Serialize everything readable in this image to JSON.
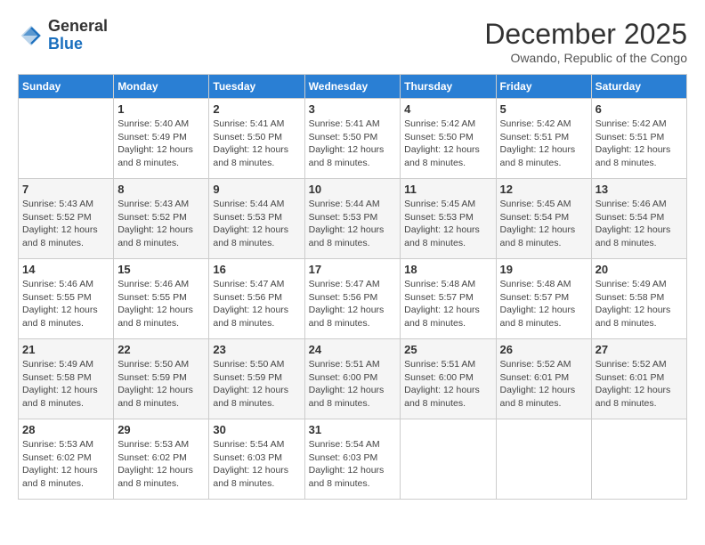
{
  "logo": {
    "general": "General",
    "blue": "Blue"
  },
  "header": {
    "month": "December 2025",
    "location": "Owando, Republic of the Congo"
  },
  "days_of_week": [
    "Sunday",
    "Monday",
    "Tuesday",
    "Wednesday",
    "Thursday",
    "Friday",
    "Saturday"
  ],
  "weeks": [
    [
      {
        "day": "",
        "info": ""
      },
      {
        "day": "1",
        "info": "Sunrise: 5:40 AM\nSunset: 5:49 PM\nDaylight: 12 hours\nand 8 minutes."
      },
      {
        "day": "2",
        "info": "Sunrise: 5:41 AM\nSunset: 5:50 PM\nDaylight: 12 hours\nand 8 minutes."
      },
      {
        "day": "3",
        "info": "Sunrise: 5:41 AM\nSunset: 5:50 PM\nDaylight: 12 hours\nand 8 minutes."
      },
      {
        "day": "4",
        "info": "Sunrise: 5:42 AM\nSunset: 5:50 PM\nDaylight: 12 hours\nand 8 minutes."
      },
      {
        "day": "5",
        "info": "Sunrise: 5:42 AM\nSunset: 5:51 PM\nDaylight: 12 hours\nand 8 minutes."
      },
      {
        "day": "6",
        "info": "Sunrise: 5:42 AM\nSunset: 5:51 PM\nDaylight: 12 hours\nand 8 minutes."
      }
    ],
    [
      {
        "day": "7",
        "info": "Sunrise: 5:43 AM\nSunset: 5:52 PM\nDaylight: 12 hours\nand 8 minutes."
      },
      {
        "day": "8",
        "info": "Sunrise: 5:43 AM\nSunset: 5:52 PM\nDaylight: 12 hours\nand 8 minutes."
      },
      {
        "day": "9",
        "info": "Sunrise: 5:44 AM\nSunset: 5:53 PM\nDaylight: 12 hours\nand 8 minutes."
      },
      {
        "day": "10",
        "info": "Sunrise: 5:44 AM\nSunset: 5:53 PM\nDaylight: 12 hours\nand 8 minutes."
      },
      {
        "day": "11",
        "info": "Sunrise: 5:45 AM\nSunset: 5:53 PM\nDaylight: 12 hours\nand 8 minutes."
      },
      {
        "day": "12",
        "info": "Sunrise: 5:45 AM\nSunset: 5:54 PM\nDaylight: 12 hours\nand 8 minutes."
      },
      {
        "day": "13",
        "info": "Sunrise: 5:46 AM\nSunset: 5:54 PM\nDaylight: 12 hours\nand 8 minutes."
      }
    ],
    [
      {
        "day": "14",
        "info": "Sunrise: 5:46 AM\nSunset: 5:55 PM\nDaylight: 12 hours\nand 8 minutes."
      },
      {
        "day": "15",
        "info": "Sunrise: 5:46 AM\nSunset: 5:55 PM\nDaylight: 12 hours\nand 8 minutes."
      },
      {
        "day": "16",
        "info": "Sunrise: 5:47 AM\nSunset: 5:56 PM\nDaylight: 12 hours\nand 8 minutes."
      },
      {
        "day": "17",
        "info": "Sunrise: 5:47 AM\nSunset: 5:56 PM\nDaylight: 12 hours\nand 8 minutes."
      },
      {
        "day": "18",
        "info": "Sunrise: 5:48 AM\nSunset: 5:57 PM\nDaylight: 12 hours\nand 8 minutes."
      },
      {
        "day": "19",
        "info": "Sunrise: 5:48 AM\nSunset: 5:57 PM\nDaylight: 12 hours\nand 8 minutes."
      },
      {
        "day": "20",
        "info": "Sunrise: 5:49 AM\nSunset: 5:58 PM\nDaylight: 12 hours\nand 8 minutes."
      }
    ],
    [
      {
        "day": "21",
        "info": "Sunrise: 5:49 AM\nSunset: 5:58 PM\nDaylight: 12 hours\nand 8 minutes."
      },
      {
        "day": "22",
        "info": "Sunrise: 5:50 AM\nSunset: 5:59 PM\nDaylight: 12 hours\nand 8 minutes."
      },
      {
        "day": "23",
        "info": "Sunrise: 5:50 AM\nSunset: 5:59 PM\nDaylight: 12 hours\nand 8 minutes."
      },
      {
        "day": "24",
        "info": "Sunrise: 5:51 AM\nSunset: 6:00 PM\nDaylight: 12 hours\nand 8 minutes."
      },
      {
        "day": "25",
        "info": "Sunrise: 5:51 AM\nSunset: 6:00 PM\nDaylight: 12 hours\nand 8 minutes."
      },
      {
        "day": "26",
        "info": "Sunrise: 5:52 AM\nSunset: 6:01 PM\nDaylight: 12 hours\nand 8 minutes."
      },
      {
        "day": "27",
        "info": "Sunrise: 5:52 AM\nSunset: 6:01 PM\nDaylight: 12 hours\nand 8 minutes."
      }
    ],
    [
      {
        "day": "28",
        "info": "Sunrise: 5:53 AM\nSunset: 6:02 PM\nDaylight: 12 hours\nand 8 minutes."
      },
      {
        "day": "29",
        "info": "Sunrise: 5:53 AM\nSunset: 6:02 PM\nDaylight: 12 hours\nand 8 minutes."
      },
      {
        "day": "30",
        "info": "Sunrise: 5:54 AM\nSunset: 6:03 PM\nDaylight: 12 hours\nand 8 minutes."
      },
      {
        "day": "31",
        "info": "Sunrise: 5:54 AM\nSunset: 6:03 PM\nDaylight: 12 hours\nand 8 minutes."
      },
      {
        "day": "",
        "info": ""
      },
      {
        "day": "",
        "info": ""
      },
      {
        "day": "",
        "info": ""
      }
    ]
  ]
}
